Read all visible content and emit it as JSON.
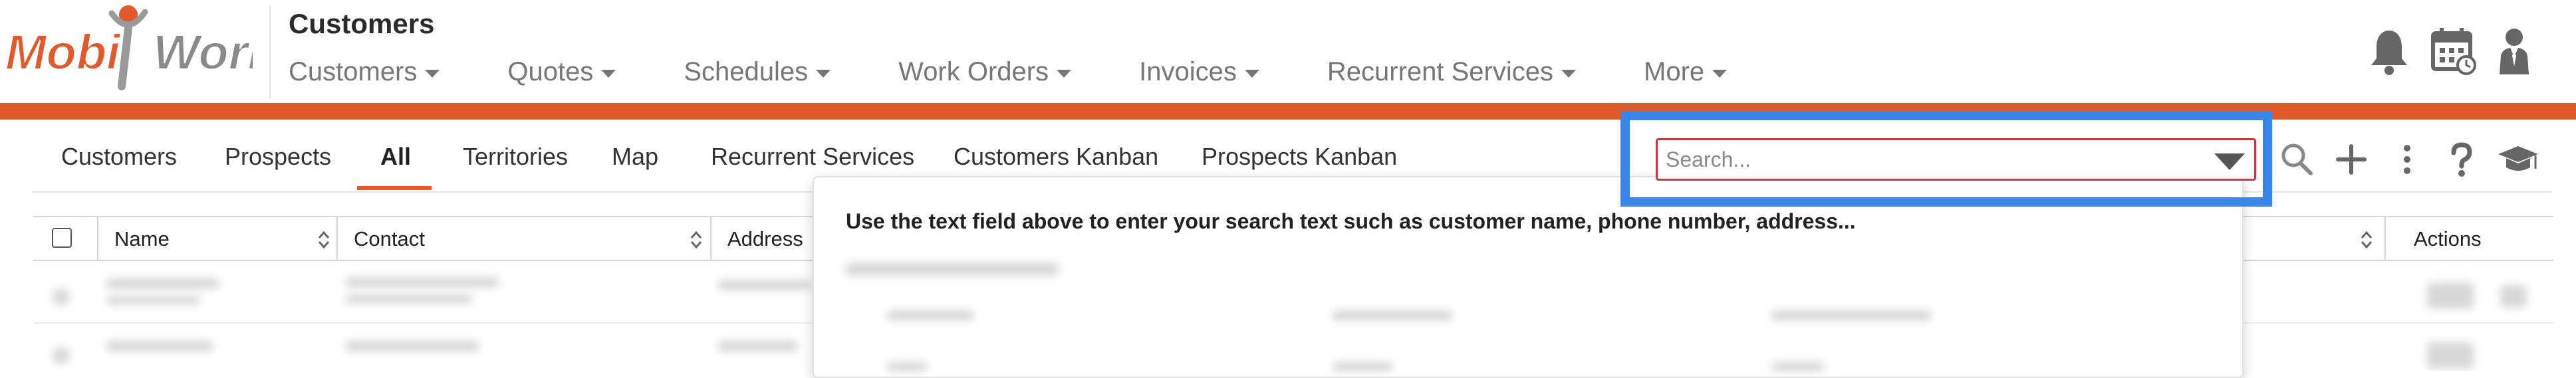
{
  "brand": {
    "logo_left": "Mobi",
    "logo_right": "Work",
    "accent_color": "#e05a2b",
    "highlight_color": "#3a86e8"
  },
  "header": {
    "title": "Customers",
    "nav": [
      {
        "label": "Customers"
      },
      {
        "label": "Quotes"
      },
      {
        "label": "Schedules"
      },
      {
        "label": "Work Orders"
      },
      {
        "label": "Invoices"
      },
      {
        "label": "Recurrent Services"
      },
      {
        "label": "More"
      }
    ],
    "icons": [
      "bell-icon",
      "calendar-icon",
      "user-icon"
    ]
  },
  "subtabs": {
    "items": [
      {
        "label": "Customers"
      },
      {
        "label": "Prospects"
      },
      {
        "label": "All"
      },
      {
        "label": "Territories"
      },
      {
        "label": "Map"
      },
      {
        "label": "Recurrent Services"
      },
      {
        "label": "Customers Kanban"
      },
      {
        "label": "Prospects Kanban"
      }
    ],
    "active": "All"
  },
  "search": {
    "placeholder": "Search...",
    "value": "",
    "hint": "Use the text field above to enter your search text such as customer name, phone number, address..."
  },
  "toolbar": {
    "icons": [
      "search-icon",
      "plus-icon",
      "more-vertical-icon",
      "help-icon",
      "graduation-cap-icon"
    ]
  },
  "table": {
    "columns": [
      "Name",
      "Contact",
      "Address",
      "Actions"
    ]
  }
}
